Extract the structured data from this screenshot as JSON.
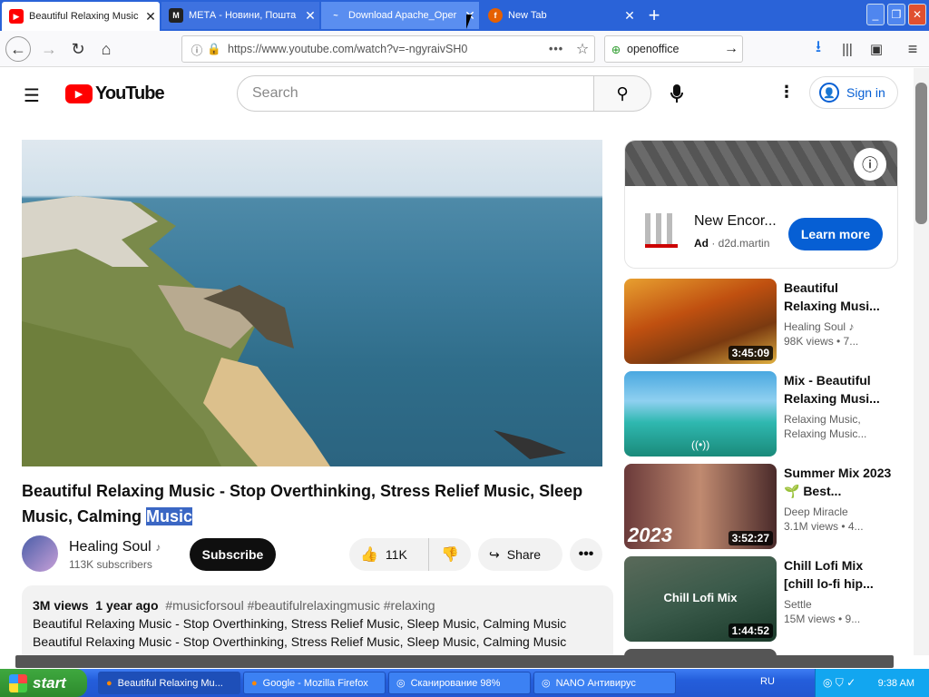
{
  "browser": {
    "tabs": [
      {
        "title": "Beautiful Relaxing Music",
        "favicon": "youtube-icon",
        "active": true
      },
      {
        "title": "МЕТА - Новини, Пошта",
        "favicon": "meta-icon"
      },
      {
        "title": "Download Apache_Oper",
        "favicon": "apache-icon"
      },
      {
        "title": "New Tab",
        "favicon": "firefox-icon"
      }
    ],
    "url": "https://www.youtube.com/watch?v=-ngyraivSH0",
    "search_value": "openoffice"
  },
  "youtube": {
    "logo_text": "YouTube",
    "search_placeholder": "Search",
    "sign_in": "Sign in",
    "video": {
      "title": "Beautiful Relaxing Music - Stop Overthinking, Stress Relief Music, Sleep Music, Calming",
      "title_highlight": "Music",
      "channel": "Healing Soul",
      "subscribers": "113K subscribers",
      "subscribe": "Subscribe",
      "likes": "11K",
      "share": "Share",
      "views": "3M views",
      "age": "1 year ago",
      "tags": "#musicforsoul #beautifulrelaxingmusic #relaxing",
      "desc_line1": "Beautiful Relaxing Music - Stop Overthinking, Stress Relief Music, Sleep Music, Calming Music",
      "desc_line2": "Beautiful Relaxing Music - Stop Overthinking, Stress Relief Music, Sleep Music, Calming Music"
    },
    "ad": {
      "title": "New Encor...",
      "label": "Ad",
      "domain": "d2d.martin",
      "cta": "Learn more"
    },
    "recommendations": [
      {
        "title": "Beautiful Relaxing Musi...",
        "channel": "Healing Soul",
        "meta": "98K views • 7...",
        "duration": "3:45:09"
      },
      {
        "title": "Mix - Beautiful Relaxing Musi...",
        "channel": "Relaxing Music,",
        "channel2": "Relaxing Music...",
        "meta": "",
        "duration": ""
      },
      {
        "title": "Summer Mix 2023🌱 Best...",
        "channel": "Deep Miracle",
        "meta": "3.1M views • 4...",
        "duration": "3:52:27",
        "overlay": "2023"
      },
      {
        "title": "Chill Lofi Mix [chill lo-fi hip...",
        "channel": "Settle",
        "meta": "15M views • 9...",
        "duration": "1:44:52",
        "overlay": "Chill Lofi Mix"
      }
    ]
  },
  "taskbar": {
    "start": "start",
    "items": [
      {
        "label": "Beautiful Relaxing Mu...",
        "icon": "firefox-icon",
        "active": true
      },
      {
        "label": "Google - Mozilla Firefox",
        "icon": "firefox-icon"
      },
      {
        "label": "Сканирование 98%",
        "icon": "nano-icon"
      },
      {
        "label": "NANO Антивирус",
        "icon": "nano-icon"
      }
    ],
    "lang": "RU",
    "clock": "9:38 AM"
  }
}
